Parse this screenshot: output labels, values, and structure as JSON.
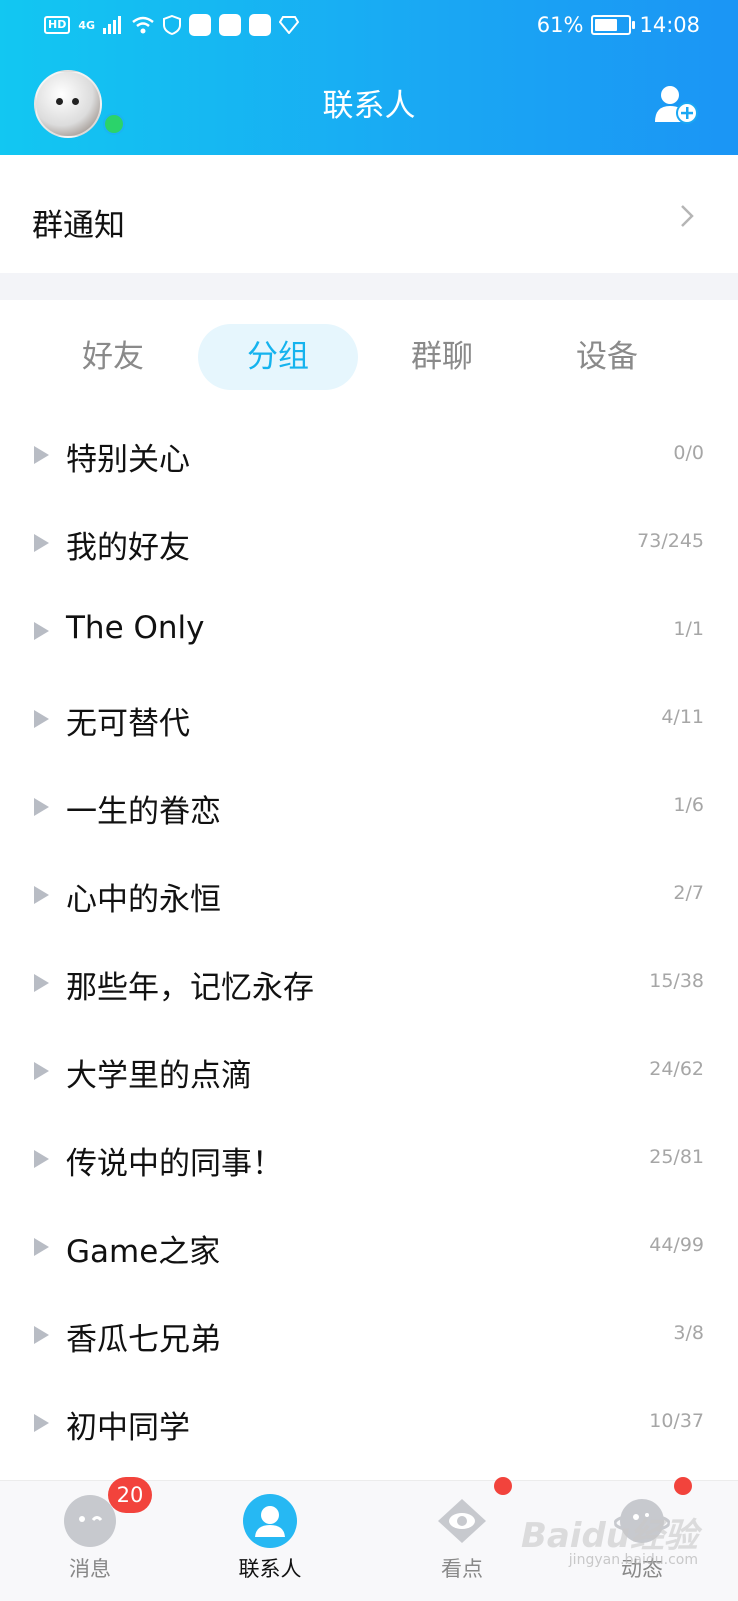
{
  "status_bar": {
    "hd": "HD",
    "network": "4G",
    "battery": "61%",
    "time": "14:08"
  },
  "header": {
    "title": "联系人",
    "avatar_icon": "user-avatar",
    "add_icon": "add-contact-icon"
  },
  "group_notice": {
    "label": "群通知"
  },
  "tabs": [
    {
      "label": "好友",
      "active": false
    },
    {
      "label": "分组",
      "active": true
    },
    {
      "label": "群聊",
      "active": false
    },
    {
      "label": "设备",
      "active": false
    }
  ],
  "groups": [
    {
      "name": "特别关心",
      "count": "0/0"
    },
    {
      "name": "我的好友",
      "count": "73/245"
    },
    {
      "name": "The Only",
      "count": "1/1"
    },
    {
      "name": "无可替代",
      "count": "4/11"
    },
    {
      "name": "一生的眷恋",
      "count": "1/6"
    },
    {
      "name": "心中的永恒",
      "count": "2/7"
    },
    {
      "name": "那些年，记忆永存",
      "count": "15/38"
    },
    {
      "name": "大学里的点滴",
      "count": "24/62"
    },
    {
      "name": "传说中的同事！",
      "count": "25/81"
    },
    {
      "name": "Game之家",
      "count": "44/99"
    },
    {
      "name": "香瓜七兄弟",
      "count": "3/8"
    },
    {
      "name": "初中同学",
      "count": "10/37"
    }
  ],
  "bottom_nav": [
    {
      "label": "消息",
      "badge": "20",
      "icon": "message-icon"
    },
    {
      "label": "联系人",
      "icon": "contacts-icon",
      "active": true
    },
    {
      "label": "看点",
      "icon": "eye-icon",
      "dot": true
    },
    {
      "label": "动态",
      "icon": "planet-icon",
      "dot": true
    }
  ],
  "watermark": {
    "text": "Baidu经验",
    "sub": "jingyan.baidu.com"
  },
  "colors": {
    "accent": "#15b3ee",
    "badge": "#f2433c",
    "online": "#2bd36a"
  }
}
